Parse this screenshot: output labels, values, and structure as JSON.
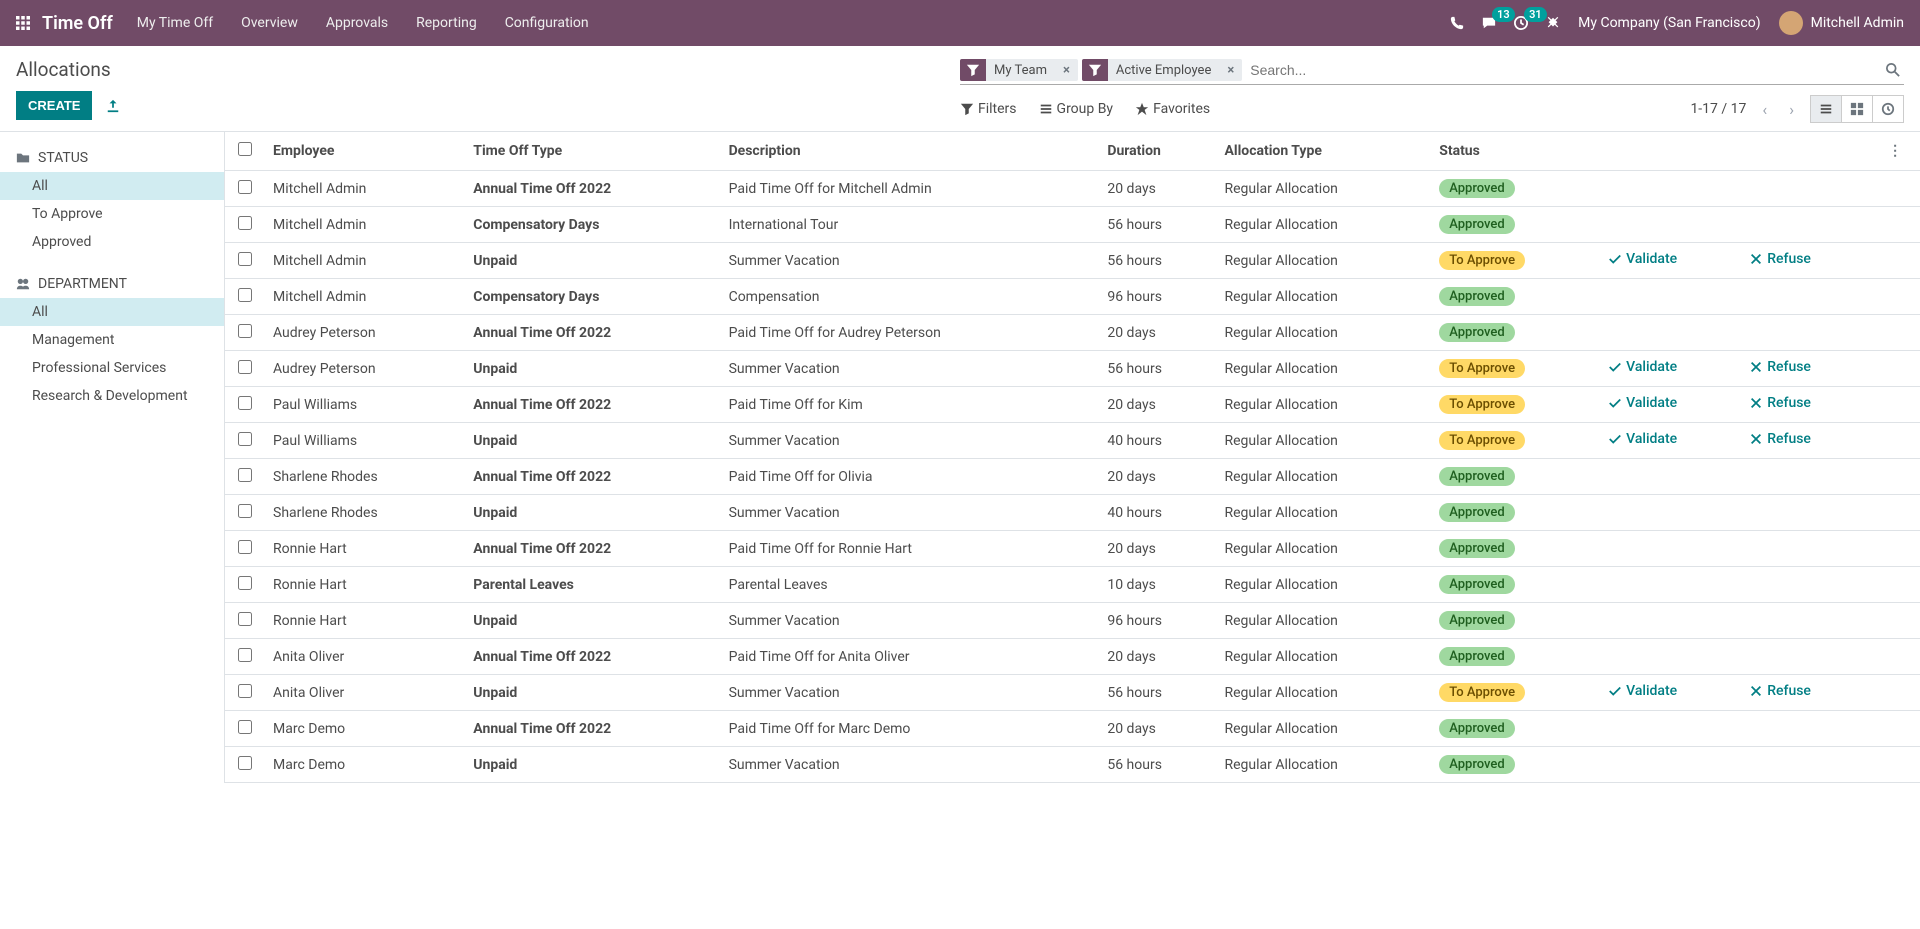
{
  "topnav": {
    "brand": "Time Off",
    "menu": [
      "My Time Off",
      "Overview",
      "Approvals",
      "Reporting",
      "Configuration"
    ],
    "chat_badge": "13",
    "activity_badge": "31",
    "company": "My Company (San Francisco)",
    "user": "Mitchell Admin"
  },
  "header": {
    "title": "Allocations",
    "create": "CREATE"
  },
  "search": {
    "facets": [
      {
        "label": "My Team"
      },
      {
        "label": "Active Employee"
      }
    ],
    "placeholder": "Search..."
  },
  "toolbar": {
    "filters": "Filters",
    "groupby": "Group By",
    "favorites": "Favorites",
    "pager": "1-17 / 17"
  },
  "sidebar": {
    "status_header": "STATUS",
    "status_items": [
      {
        "label": "All",
        "active": true
      },
      {
        "label": "To Approve",
        "active": false
      },
      {
        "label": "Approved",
        "active": false
      }
    ],
    "dept_header": "DEPARTMENT",
    "dept_items": [
      {
        "label": "All",
        "active": true
      },
      {
        "label": "Management",
        "active": false
      },
      {
        "label": "Professional Services",
        "active": false
      },
      {
        "label": "Research & Development",
        "active": false
      }
    ]
  },
  "table": {
    "headers": {
      "employee": "Employee",
      "type": "Time Off Type",
      "description": "Description",
      "duration": "Duration",
      "alloc_type": "Allocation Type",
      "status": "Status"
    },
    "actions": {
      "validate": "Validate",
      "refuse": "Refuse"
    },
    "status_labels": {
      "approved": "Approved",
      "to_approve": "To Approve"
    },
    "rows": [
      {
        "employee": "Mitchell Admin",
        "type": "Annual Time Off 2022",
        "description": "Paid Time Off for Mitchell Admin",
        "duration": "20 days",
        "alloc_type": "Regular Allocation",
        "status": "approved"
      },
      {
        "employee": "Mitchell Admin",
        "type": "Compensatory Days",
        "description": "International Tour",
        "duration": "56 hours",
        "alloc_type": "Regular Allocation",
        "status": "approved"
      },
      {
        "employee": "Mitchell Admin",
        "type": "Unpaid",
        "description": "Summer Vacation",
        "duration": "56 hours",
        "alloc_type": "Regular Allocation",
        "status": "to_approve"
      },
      {
        "employee": "Mitchell Admin",
        "type": "Compensatory Days",
        "description": "Compensation",
        "duration": "96 hours",
        "alloc_type": "Regular Allocation",
        "status": "approved"
      },
      {
        "employee": "Audrey Peterson",
        "type": "Annual Time Off 2022",
        "description": "Paid Time Off for Audrey Peterson",
        "duration": "20 days",
        "alloc_type": "Regular Allocation",
        "status": "approved"
      },
      {
        "employee": "Audrey Peterson",
        "type": "Unpaid",
        "description": "Summer Vacation",
        "duration": "56 hours",
        "alloc_type": "Regular Allocation",
        "status": "to_approve"
      },
      {
        "employee": "Paul Williams",
        "type": "Annual Time Off 2022",
        "description": "Paid Time Off for Kim",
        "duration": "20 days",
        "alloc_type": "Regular Allocation",
        "status": "to_approve"
      },
      {
        "employee": "Paul Williams",
        "type": "Unpaid",
        "description": "Summer Vacation",
        "duration": "40 hours",
        "alloc_type": "Regular Allocation",
        "status": "to_approve"
      },
      {
        "employee": "Sharlene Rhodes",
        "type": "Annual Time Off 2022",
        "description": "Paid Time Off for Olivia",
        "duration": "20 days",
        "alloc_type": "Regular Allocation",
        "status": "approved"
      },
      {
        "employee": "Sharlene Rhodes",
        "type": "Unpaid",
        "description": "Summer Vacation",
        "duration": "40 hours",
        "alloc_type": "Regular Allocation",
        "status": "approved"
      },
      {
        "employee": "Ronnie Hart",
        "type": "Annual Time Off 2022",
        "description": "Paid Time Off for Ronnie Hart",
        "duration": "20 days",
        "alloc_type": "Regular Allocation",
        "status": "approved"
      },
      {
        "employee": "Ronnie Hart",
        "type": "Parental Leaves",
        "description": "Parental Leaves",
        "duration": "10 days",
        "alloc_type": "Regular Allocation",
        "status": "approved"
      },
      {
        "employee": "Ronnie Hart",
        "type": "Unpaid",
        "description": "Summer Vacation",
        "duration": "96 hours",
        "alloc_type": "Regular Allocation",
        "status": "approved"
      },
      {
        "employee": "Anita Oliver",
        "type": "Annual Time Off 2022",
        "description": "Paid Time Off for Anita Oliver",
        "duration": "20 days",
        "alloc_type": "Regular Allocation",
        "status": "approved"
      },
      {
        "employee": "Anita Oliver",
        "type": "Unpaid",
        "description": "Summer Vacation",
        "duration": "56 hours",
        "alloc_type": "Regular Allocation",
        "status": "to_approve"
      },
      {
        "employee": "Marc Demo",
        "type": "Annual Time Off 2022",
        "description": "Paid Time Off for Marc Demo",
        "duration": "20 days",
        "alloc_type": "Regular Allocation",
        "status": "approved"
      },
      {
        "employee": "Marc Demo",
        "type": "Unpaid",
        "description": "Summer Vacation",
        "duration": "56 hours",
        "alloc_type": "Regular Allocation",
        "status": "approved"
      }
    ]
  }
}
